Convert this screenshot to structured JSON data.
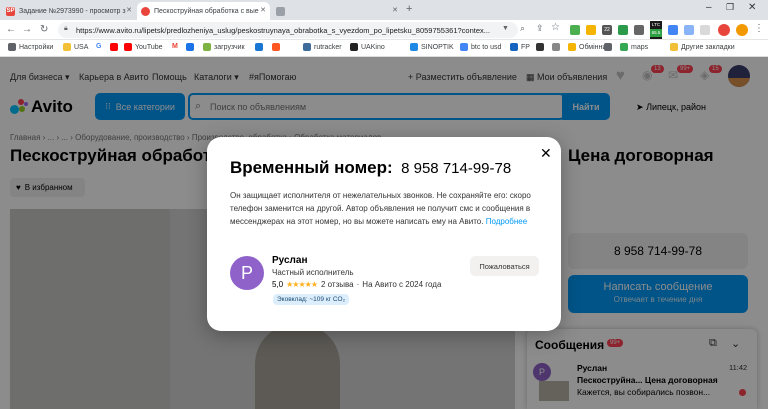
{
  "browser": {
    "tabs": [
      {
        "label": "Задание №2973990 - просмотр з",
        "favicon": "SP",
        "color": "#e8453c"
      },
      {
        "label": "Пескоструйная обработка с вые",
        "favicon": "",
        "color": "#e8453c"
      },
      {
        "label": "",
        "favicon": "",
        "color": "#5f6368"
      }
    ],
    "url": "https://www.avito.ru/lipetsk/predlozheniya_uslug/peskostruynaya_obrabotka_s_vyezdom_po_lipetsku_8059755361?contex...",
    "extensions": {
      "badge_1": "22",
      "ltc_label": "LTC",
      "ltc_value": "65.5"
    },
    "bookmarks": [
      "Настройки",
      "USA",
      "G",
      "",
      "YouTube",
      "M",
      "",
      "загрузчик",
      "",
      "",
      "rutracker",
      "UAKino",
      "SINOPTIK",
      "btc to usd",
      "FP",
      "",
      "",
      "Обмінник",
      "",
      "maps",
      "Другие закладки"
    ]
  },
  "header": {
    "top_links": [
      "Для бизнеса",
      "Карьера в Авито",
      "Помощь",
      "Каталоги",
      "#яПомогаю"
    ],
    "post_ad": "Разместить объявление",
    "my_ads": "Мои объявления",
    "badges": [
      "13",
      "99+",
      "15"
    ],
    "logo": "Avito",
    "categories_btn": "Все категории",
    "search_placeholder": "Поиск по объявлениям",
    "find_btn": "Найти",
    "location": "Липецк, район"
  },
  "listing": {
    "breadcrumbs": "Главная › ... › ... › Оборудование, производство › Производство, обработка › Обработка материалов",
    "title": "Пескоструйная обработка с выездом по Липецку",
    "price": "Цена договорная",
    "favorites": "В избранном",
    "phone": "8 958 714-99-78",
    "message_btn": "Написать сообщение",
    "message_sub": "Отвечает в течение дня"
  },
  "messages": {
    "title": "Сообщения",
    "badge": "99+",
    "item": {
      "name": "Руслан",
      "time": "11:42",
      "subject": "Пескоструйна...  Цена договорная",
      "preview": "Кажется, вы собирались позвон..."
    }
  },
  "modal": {
    "title_prefix": "Временный номер:",
    "phone": "8 958 714-99-78",
    "description": "Он защищает исполнителя от нежелательных звонков. Не сохраняйте его: скоро телефон заменится на другой. Автор объявления не получит смс и сообщения в мессенджерах на этот номер, но вы можете написать ему на Авито.",
    "more_link": "Подробнее",
    "seller": {
      "avatar_letter": "Р",
      "name": "Руслан",
      "type": "Частный исполнитель",
      "rating": "5,0",
      "stars": 5,
      "reviews": "2 отзыва",
      "since": "На Авито с 2024 года",
      "eco_badge": "Эковклад: ~109 кг CO₂"
    },
    "complain_btn": "Пожаловаться",
    "colors": {
      "accent": "#0099f7",
      "link": "#0099f7",
      "avatar": "#8e62c9",
      "star": "#ffb021",
      "eco_bg": "#dcedfb"
    }
  }
}
